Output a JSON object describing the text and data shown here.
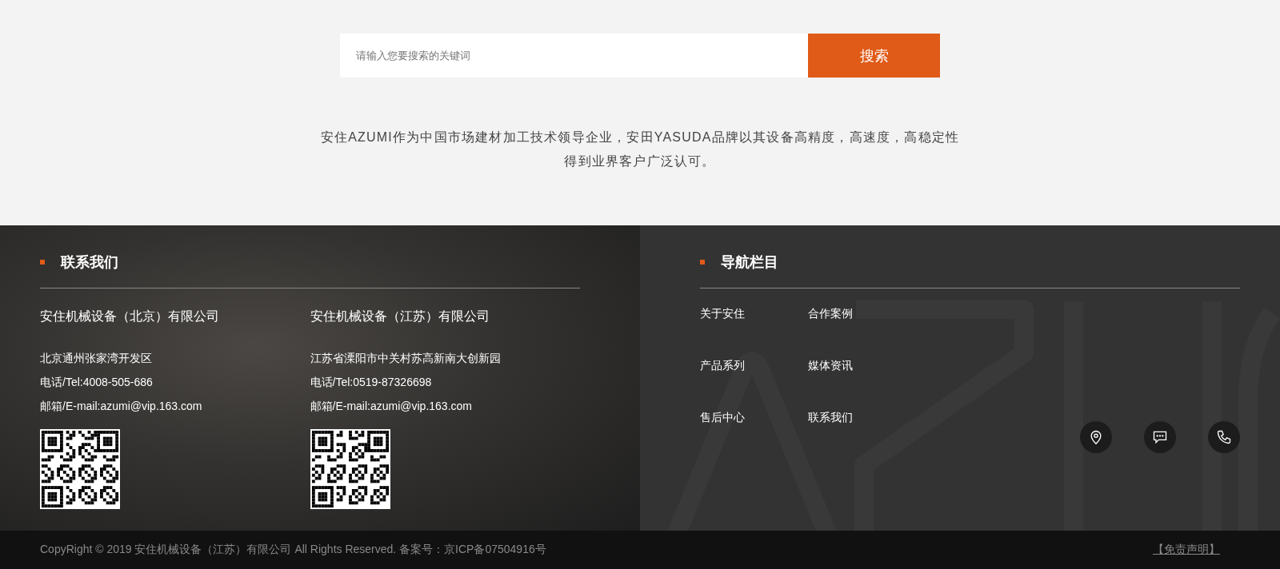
{
  "search": {
    "placeholder": "请输入您要搜索的关键词",
    "button": "搜索"
  },
  "intro": "安住AZUMI作为中国市场建材加工技术领导企业，安田YASUDA品牌以其设备高精度，高速度，高稳定性得到业界客户广泛认可。",
  "contact": {
    "title": "联系我们",
    "companies": [
      {
        "name": "安住机械设备（北京）有限公司",
        "lines": [
          "北京通州张家湾开发区",
          "电话/Tel:4008-505-686",
          "邮箱/E-mail:azumi@vip.163.com"
        ]
      },
      {
        "name": "安住机械设备（江苏）有限公司",
        "lines": [
          "江苏省溧阳市中关村苏高新南大创新园",
          "电话/Tel:0519-87326698",
          "邮箱/E-mail:azumi@vip.163.com"
        ]
      }
    ]
  },
  "nav": {
    "title": "导航栏目",
    "items": [
      "关于安住",
      "合作案例",
      "产品系列",
      "媒体资讯",
      "售后中心",
      "联系我们"
    ],
    "contact_icons": [
      {
        "kind": "location"
      },
      {
        "kind": "message"
      },
      {
        "kind": "phone"
      }
    ]
  },
  "footer": {
    "copyright": "CopyRight © 2019 安住机械设备（江苏）有限公司 All Rights Reserved. 备案号：京ICP备07504916号",
    "disclaimer": "【免责声明】"
  }
}
